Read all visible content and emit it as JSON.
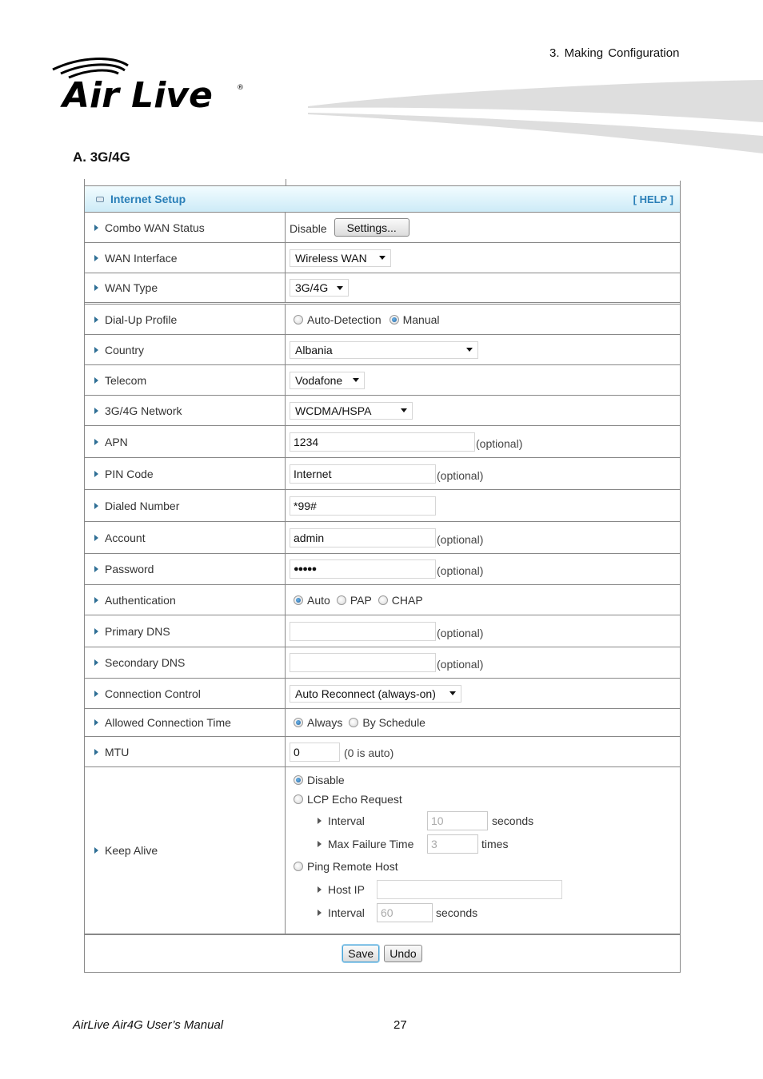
{
  "document": {
    "chapter": "3.  Making  Configuration",
    "brand": "Air Live",
    "section_title": "A. 3G/4G",
    "footer_title": "AirLive Air4G User’s Manual",
    "page_number": "27"
  },
  "panel": {
    "title": "Internet Setup",
    "help": "[ HELP ]",
    "rows": {
      "combo_wan_status": {
        "label": "Combo WAN Status",
        "value": "Disable",
        "button": "Settings..."
      },
      "wan_interface": {
        "label": "WAN Interface",
        "value": "Wireless WAN"
      },
      "wan_type": {
        "label": "WAN Type",
        "value": "3G/4G"
      },
      "dialup_profile": {
        "label": "Dial-Up Profile",
        "options": [
          "Auto-Detection",
          "Manual"
        ],
        "selected": "Manual"
      },
      "country": {
        "label": "Country",
        "value": "Albania"
      },
      "telecom": {
        "label": "Telecom",
        "value": "Vodafone"
      },
      "network": {
        "label": "3G/4G Network",
        "value": "WCDMA/HSPA"
      },
      "apn": {
        "label": "APN",
        "value": "1234",
        "hint": "(optional)"
      },
      "pin": {
        "label": "PIN Code",
        "value": "Internet",
        "hint": "(optional)"
      },
      "dialed": {
        "label": "Dialed Number",
        "value": "*99#"
      },
      "account": {
        "label": "Account",
        "value": "admin",
        "hint": "(optional)"
      },
      "password": {
        "label": "Password",
        "value": "●●●●●",
        "hint": "(optional)"
      },
      "auth": {
        "label": "Authentication",
        "options": [
          "Auto",
          "PAP",
          "CHAP"
        ],
        "selected": "Auto"
      },
      "primary_dns": {
        "label": "Primary DNS",
        "value": "",
        "hint": "(optional)"
      },
      "secondary_dns": {
        "label": "Secondary DNS",
        "value": "",
        "hint": "(optional)"
      },
      "conn_control": {
        "label": "Connection Control",
        "value": "Auto Reconnect (always-on)"
      },
      "allowed_time": {
        "label": "Allowed Connection Time",
        "options": [
          "Always",
          "By Schedule"
        ],
        "selected": "Always"
      },
      "mtu": {
        "label": "MTU",
        "value": "0",
        "hint": "(0 is auto)"
      },
      "keep_alive": {
        "label": "Keep Alive",
        "opt_disable": "Disable",
        "opt_lcp": "LCP Echo Request",
        "lcp_interval_label": "Interval",
        "lcp_interval_value": "10",
        "lcp_interval_unit": "seconds",
        "lcp_max_label": "Max Failure Time",
        "lcp_max_value": "3",
        "lcp_max_unit": "times",
        "opt_ping": "Ping Remote Host",
        "host_ip_label": "Host IP",
        "host_ip_value": "",
        "ping_interval_label": "Interval",
        "ping_interval_value": "60",
        "ping_interval_unit": "seconds",
        "selected": "Disable"
      }
    },
    "save": "Save",
    "undo": "Undo"
  }
}
